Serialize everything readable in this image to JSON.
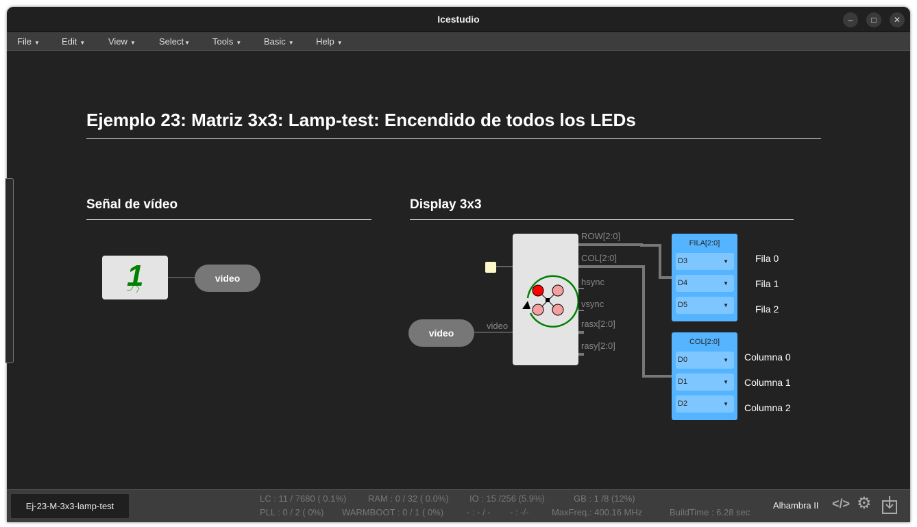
{
  "window": {
    "title": "Icestudio",
    "buttons": [
      "minimize",
      "maximize",
      "close"
    ]
  },
  "menu": [
    "File",
    "Edit",
    "View",
    "Select",
    "Tools",
    "Basic",
    "Help"
  ],
  "canvas": {
    "title": "Ejemplo 23: Matriz 3x3: Lamp-test: Encendido de todos los LEDs",
    "section_video": "Señal de vídeo",
    "section_display": "Display 3x3",
    "video_out_label": "video",
    "video_in_label": "video",
    "video_port_label": "video",
    "block_ports": [
      "ROW[2:0]",
      "COL[2:0]",
      "hsync",
      "vsync",
      "rasx[2:0]",
      "rasy[2:0]"
    ],
    "fila": {
      "title": "FILA[2:0]",
      "pins": [
        "D3",
        "D4",
        "D5"
      ],
      "labels": [
        "Fila 0",
        "Fila 1",
        "Fila 2"
      ]
    },
    "col": {
      "title": "COL[2:0]",
      "pins": [
        "D0",
        "D1",
        "D2"
      ],
      "labels": [
        "Columna 0",
        "Columna 1",
        "Columna 2"
      ]
    }
  },
  "footer": {
    "project": "Ej-23-M-3x3-lamp-test",
    "stats1": [
      "LC : 11 / 7680 ( 0.1%)",
      "RAM : 0 / 32 ( 0.0%)",
      "IO : 15 /256 (5.9%)",
      "GB : 1 /8 (12%)"
    ],
    "stats2": [
      "PLL : 0 / 2 ( 0%)",
      "WARMBOOT : 0 / 1 ( 0%)",
      "- : - / -",
      "- : -/-",
      "MaxFreq.: 400.16 MHz",
      "BuildTime : 6.28 sec"
    ],
    "board": "Alhambra II"
  }
}
